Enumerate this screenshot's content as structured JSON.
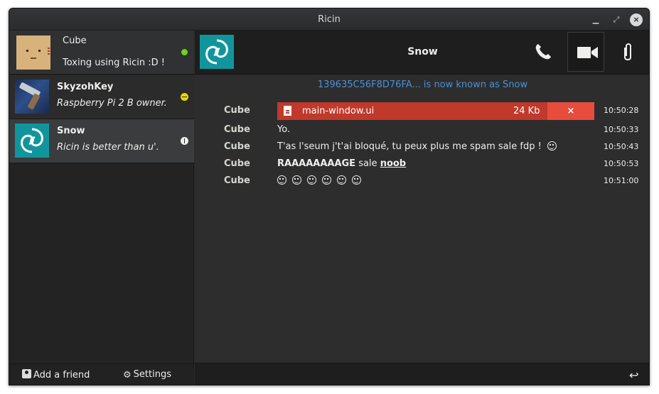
{
  "window": {
    "title": "Ricin"
  },
  "profile": {
    "name": "Cube",
    "status_message": "Toxing using Ricin :D !",
    "status": "online",
    "status_color": "#73d216"
  },
  "friends": [
    {
      "name": "SkyzohKey",
      "status_message": "Raspberry Pi 2 B owner.",
      "status": "away"
    },
    {
      "name": "Snow",
      "status_message": "Ricin is better than u'.",
      "status": "offline"
    }
  ],
  "sidebar_bottom": {
    "add_friend": "Add a friend",
    "settings": "Settings"
  },
  "chat": {
    "contact_name": "Snow",
    "notice": "139635C56F8D76FA... is now known as Snow",
    "file_transfer": {
      "sender": "Cube",
      "filename": "main-window.ui",
      "size": "24 Kb",
      "cancel": "×",
      "time": "10:50:28"
    },
    "messages": [
      {
        "sender": "Cube",
        "text": "Yo.",
        "time": "10:50:33"
      },
      {
        "sender": "Cube",
        "text": "T'as l'seum j't'ai bloqué, tu peux plus me spam sale fdp !",
        "time": "10:50:43"
      },
      {
        "sender": "Cube",
        "text_bold": "RAAAAAAAAGE",
        "text_mid": " sale ",
        "text_link": "noob",
        "time": "10:50:53"
      },
      {
        "sender": "Cube",
        "emoji_count": 6,
        "time": "10:51:00"
      }
    ]
  },
  "colors": {
    "accent": "#4a90d9",
    "file_bar": "#c0392b",
    "cancel": "#e74c3c",
    "snow_avatar": "#11959c"
  }
}
